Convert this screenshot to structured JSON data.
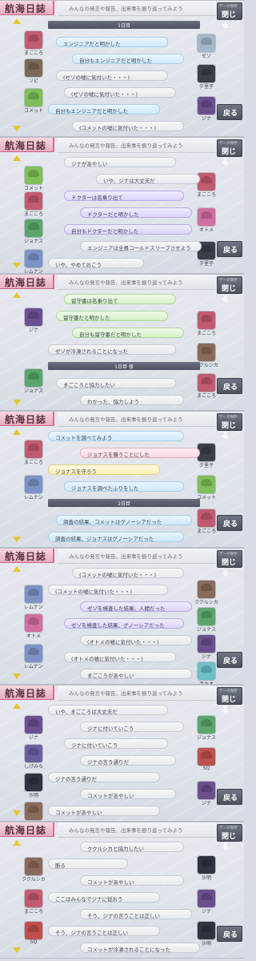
{
  "app": {
    "title": "航海日誌",
    "subtitle": "みんなの発言や報告、出来事を振り返ってみよう",
    "close_small": "データ保存",
    "close_label": "閉じる",
    "back_label": "戻る"
  },
  "colors": {
    "blue": "#cfe8fb",
    "purple": "#dcd3fb",
    "green": "#d5f2c8",
    "yellow": "#f8eeb5",
    "pink": "#fad7e2",
    "gray": "#e8e9ec"
  },
  "panels": [
    {
      "left_chars": [
        {
          "name": "まごころ",
          "color": "#c25b6f"
        },
        {
          "name": "ソピ",
          "color": "#7c6a58"
        },
        {
          "name": "コメット",
          "color": "#7fbf5a"
        }
      ],
      "right_chars": [
        {
          "name": "ゼゾ",
          "color": "#a2b7c9"
        },
        {
          "name": "夕里子",
          "color": "#3a3f4a"
        },
        {
          "name": "ジナ",
          "color": "#6b4f8e"
        }
      ],
      "rows": [
        {
          "type": "sep",
          "text": "1日目"
        },
        {
          "color": "blue",
          "text": "エンジニアだと明かした"
        },
        {
          "color": "blue",
          "text": "自分もエンジニアだと明かした"
        },
        {
          "color": "gray",
          "text": "(ゼゾの嘘に気付いた・・・)"
        },
        {
          "color": "gray",
          "text": "(ゼゾの嘘に気付いた・・・)"
        },
        {
          "color": "blue",
          "text": "自分もエンジニアだと明かした"
        },
        {
          "color": "gray",
          "text": "(コメットの嘘に気付いた・・・)"
        }
      ]
    },
    {
      "left_chars": [
        {
          "name": "コメット",
          "color": "#7fbf5a"
        },
        {
          "name": "まごころ",
          "color": "#c25b6f"
        },
        {
          "name": "ジョナス",
          "color": "#5aa66b"
        },
        {
          "name": "レムナン",
          "color": "#7d93c7"
        }
      ],
      "right_chars": [
        {
          "name": "まごころ",
          "color": "#c25b6f"
        },
        {
          "name": "オトメ",
          "color": "#d16fa0"
        },
        {
          "name": "夕里子",
          "color": "#3a3f4a"
        }
      ],
      "rows": [
        {
          "color": "gray",
          "text": "ジナがあやしい"
        },
        {
          "color": "gray",
          "text": "いや、ジナは大丈夫だ"
        },
        {
          "color": "purple",
          "text": "ドクターは名乗り出て"
        },
        {
          "color": "purple",
          "text": "ドクターだと明かした"
        },
        {
          "color": "purple",
          "text": "自分もドクターだと明かした"
        },
        {
          "color": "gray",
          "text": "エンジニアは全員コールドスリープさせよう"
        },
        {
          "color": "gray",
          "text": "いや、やめておこう"
        }
      ]
    },
    {
      "left_chars": [
        {
          "name": "ジナ",
          "color": "#6b4f8e"
        },
        {
          "name": "ジョナス",
          "color": "#5aa66b"
        }
      ],
      "right_chars": [
        {
          "name": "まごころ",
          "color": "#c25b6f"
        },
        {
          "name": "ククルシカ",
          "color": "#8a6a5a"
        },
        {
          "name": "まごころ",
          "color": "#c25b6f"
        }
      ],
      "rows": [
        {
          "color": "green",
          "text": "留守番は名乗り出て"
        },
        {
          "color": "green",
          "text": "留守番だと明かした"
        },
        {
          "color": "green",
          "text": "自分も留守番だと明かした"
        },
        {
          "color": "gray",
          "text": "ゼゾが冷凍されることになった"
        },
        {
          "type": "sep",
          "text": "1日目 夜"
        },
        {
          "color": "gray",
          "text": "まごころと協力したい"
        },
        {
          "color": "gray",
          "text": "わかった、協力しよう"
        }
      ]
    },
    {
      "left_chars": [
        {
          "name": "まごころ",
          "color": "#c25b6f"
        },
        {
          "name": "レムナン",
          "color": "#7d93c7"
        }
      ],
      "right_chars": [
        {
          "name": "夕里子",
          "color": "#3a3f4a"
        },
        {
          "name": "コメット",
          "color": "#7fbf5a"
        },
        {
          "name": "まごころ",
          "color": "#c25b6f"
        }
      ],
      "rows": [
        {
          "color": "blue",
          "text": "コメットを調べてみよう"
        },
        {
          "color": "pink",
          "text": "ジョナスを襲うことにした"
        },
        {
          "color": "yellow",
          "text": "ジョナスを守ろう"
        },
        {
          "color": "blue",
          "text": "ジョナスを調べたふりをした"
        },
        {
          "type": "sep",
          "text": "2日目"
        },
        {
          "color": "blue",
          "text": "調査の結果、コメットはグノーシアだった"
        },
        {
          "color": "blue",
          "text": "調査の結果、ジョナスはグノーシアだった"
        }
      ]
    },
    {
      "left_chars": [
        {
          "name": "レムナン",
          "color": "#7d93c7"
        },
        {
          "name": "オトメ",
          "color": "#d16fa0"
        },
        {
          "name": "レムナン",
          "color": "#7d93c7"
        }
      ],
      "right_chars": [
        {
          "name": "ククルシカ",
          "color": "#8a6a5a"
        },
        {
          "name": "ジョナス",
          "color": "#5aa66b"
        },
        {
          "name": "ジナ",
          "color": "#6b4f8e"
        },
        {
          "name": "ラキオ",
          "color": "#6cc0c8"
        }
      ],
      "rows": [
        {
          "color": "gray",
          "text": "(コメットの嘘に気付いた・・・)"
        },
        {
          "color": "gray",
          "text": "(コメットの嘘に気付いた・・・)"
        },
        {
          "color": "purple",
          "text": "ゼゾを検査した結果、人間だった"
        },
        {
          "color": "purple",
          "text": "ゼゾを検査した結果、グノーシアだった"
        },
        {
          "color": "gray",
          "text": "(オトメの嘘に気付いた・・・)"
        },
        {
          "color": "gray",
          "text": "(オトメの嘘に気付いた・・・)"
        },
        {
          "color": "gray",
          "text": "まごころがあやしい"
        }
      ]
    },
    {
      "left_chars": [
        {
          "name": "ジナ",
          "color": "#6b4f8e"
        },
        {
          "name": "しげみち",
          "color": "#6b5fa0"
        },
        {
          "name": "沙明",
          "color": "#2f3440"
        },
        {
          "name": "ククルシカ",
          "color": "#8a6a5a"
        }
      ],
      "right_chars": [
        {
          "name": "ジョナス",
          "color": "#5aa66b"
        },
        {
          "name": "SQ",
          "color": "#c0504d"
        },
        {
          "name": "ジナ",
          "color": "#6b4f8e"
        }
      ],
      "rows": [
        {
          "color": "gray",
          "text": "いや、まごころは大丈夫だ"
        },
        {
          "color": "gray",
          "text": "ジナに付いていこう"
        },
        {
          "color": "gray",
          "text": "ジナに付いていこう"
        },
        {
          "color": "gray",
          "text": "ジナの言う通りだ"
        },
        {
          "color": "gray",
          "text": "ジナの言う通りだ"
        },
        {
          "color": "gray",
          "text": "コメットがあやしい"
        },
        {
          "color": "gray",
          "text": "コメットがあやしい"
        }
      ]
    },
    {
      "left_chars": [
        {
          "name": "ククルシカ",
          "color": "#8a6a5a"
        },
        {
          "name": "まごころ",
          "color": "#c25b6f"
        },
        {
          "name": "SQ",
          "color": "#c0504d"
        }
      ],
      "right_chars": [
        {
          "name": "沙明",
          "color": "#2f3440"
        },
        {
          "name": "ジナ",
          "color": "#6b4f8e"
        },
        {
          "name": "沙明",
          "color": "#2f3440"
        }
      ],
      "rows": [
        {
          "color": "gray",
          "text": "ククルシカと協力したい"
        },
        {
          "color": "gray",
          "text": "断る"
        },
        {
          "color": "gray",
          "text": "コメットがあやしい"
        },
        {
          "color": "gray",
          "text": "ここはみんなでジナに従おう"
        },
        {
          "color": "gray",
          "text": "そう、ジナの言うことは正しい"
        },
        {
          "color": "gray",
          "text": "そう、ジナの言うことは正しい"
        },
        {
          "color": "gray",
          "text": "コメットが冷凍されることになった"
        }
      ]
    }
  ]
}
